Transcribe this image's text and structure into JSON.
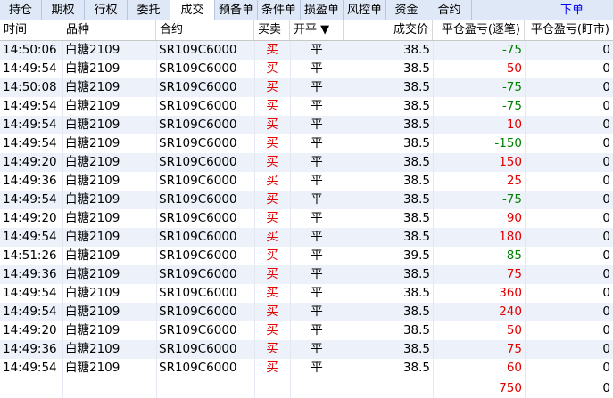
{
  "tabs": [
    "持仓",
    "期权",
    "行权",
    "委托",
    "成交",
    "预备单",
    "条件单",
    "损盈单",
    "风控单",
    "资金",
    "合约"
  ],
  "active_tab": "成交",
  "order_link": "下单",
  "columns": {
    "time": "时间",
    "variety": "品种",
    "contract": "合约",
    "side": "买卖",
    "offset": "开平 ▼",
    "price": "成交价",
    "pnl_trade": "平仓盈亏(逐笔)",
    "pnl_day": "平仓盈亏(盯市)"
  },
  "rows": [
    {
      "time": "14:50:06",
      "variety": "白糖2109",
      "contract": "SR109C6000",
      "side": "买",
      "offset": "平",
      "price": "38.5",
      "pnl_trade": "-75",
      "pnl_day": "0"
    },
    {
      "time": "14:49:54",
      "variety": "白糖2109",
      "contract": "SR109C6000",
      "side": "买",
      "offset": "平",
      "price": "38.5",
      "pnl_trade": "50",
      "pnl_day": "0"
    },
    {
      "time": "14:50:08",
      "variety": "白糖2109",
      "contract": "SR109C6000",
      "side": "买",
      "offset": "平",
      "price": "38.5",
      "pnl_trade": "-75",
      "pnl_day": "0"
    },
    {
      "time": "14:49:54",
      "variety": "白糖2109",
      "contract": "SR109C6000",
      "side": "买",
      "offset": "平",
      "price": "38.5",
      "pnl_trade": "-75",
      "pnl_day": "0"
    },
    {
      "time": "14:49:54",
      "variety": "白糖2109",
      "contract": "SR109C6000",
      "side": "买",
      "offset": "平",
      "price": "38.5",
      "pnl_trade": "10",
      "pnl_day": "0"
    },
    {
      "time": "14:49:54",
      "variety": "白糖2109",
      "contract": "SR109C6000",
      "side": "买",
      "offset": "平",
      "price": "38.5",
      "pnl_trade": "-150",
      "pnl_day": "0"
    },
    {
      "time": "14:49:20",
      "variety": "白糖2109",
      "contract": "SR109C6000",
      "side": "买",
      "offset": "平",
      "price": "38.5",
      "pnl_trade": "150",
      "pnl_day": "0"
    },
    {
      "time": "14:49:36",
      "variety": "白糖2109",
      "contract": "SR109C6000",
      "side": "买",
      "offset": "平",
      "price": "38.5",
      "pnl_trade": "25",
      "pnl_day": "0"
    },
    {
      "time": "14:49:54",
      "variety": "白糖2109",
      "contract": "SR109C6000",
      "side": "买",
      "offset": "平",
      "price": "38.5",
      "pnl_trade": "-75",
      "pnl_day": "0"
    },
    {
      "time": "14:49:20",
      "variety": "白糖2109",
      "contract": "SR109C6000",
      "side": "买",
      "offset": "平",
      "price": "38.5",
      "pnl_trade": "90",
      "pnl_day": "0"
    },
    {
      "time": "14:49:54",
      "variety": "白糖2109",
      "contract": "SR109C6000",
      "side": "买",
      "offset": "平",
      "price": "38.5",
      "pnl_trade": "180",
      "pnl_day": "0"
    },
    {
      "time": "14:51:26",
      "variety": "白糖2109",
      "contract": "SR109C6000",
      "side": "买",
      "offset": "平",
      "price": "39.5",
      "pnl_trade": "-85",
      "pnl_day": "0"
    },
    {
      "time": "14:49:36",
      "variety": "白糖2109",
      "contract": "SR109C6000",
      "side": "买",
      "offset": "平",
      "price": "38.5",
      "pnl_trade": "75",
      "pnl_day": "0"
    },
    {
      "time": "14:49:54",
      "variety": "白糖2109",
      "contract": "SR109C6000",
      "side": "买",
      "offset": "平",
      "price": "38.5",
      "pnl_trade": "360",
      "pnl_day": "0"
    },
    {
      "time": "14:49:54",
      "variety": "白糖2109",
      "contract": "SR109C6000",
      "side": "买",
      "offset": "平",
      "price": "38.5",
      "pnl_trade": "240",
      "pnl_day": "0"
    },
    {
      "time": "14:49:20",
      "variety": "白糖2109",
      "contract": "SR109C6000",
      "side": "买",
      "offset": "平",
      "price": "38.5",
      "pnl_trade": "50",
      "pnl_day": "0"
    },
    {
      "time": "14:49:36",
      "variety": "白糖2109",
      "contract": "SR109C6000",
      "side": "买",
      "offset": "平",
      "price": "38.5",
      "pnl_trade": "75",
      "pnl_day": "0"
    },
    {
      "time": "14:49:54",
      "variety": "白糖2109",
      "contract": "SR109C6000",
      "side": "买",
      "offset": "平",
      "price": "38.5",
      "pnl_trade": "60",
      "pnl_day": "0"
    }
  ],
  "totals": {
    "pnl_trade": "750",
    "pnl_day": "0"
  },
  "colors": {
    "buy": "#e00000",
    "profit": "#e00000",
    "loss": "#008000",
    "link": "#0000ff"
  }
}
